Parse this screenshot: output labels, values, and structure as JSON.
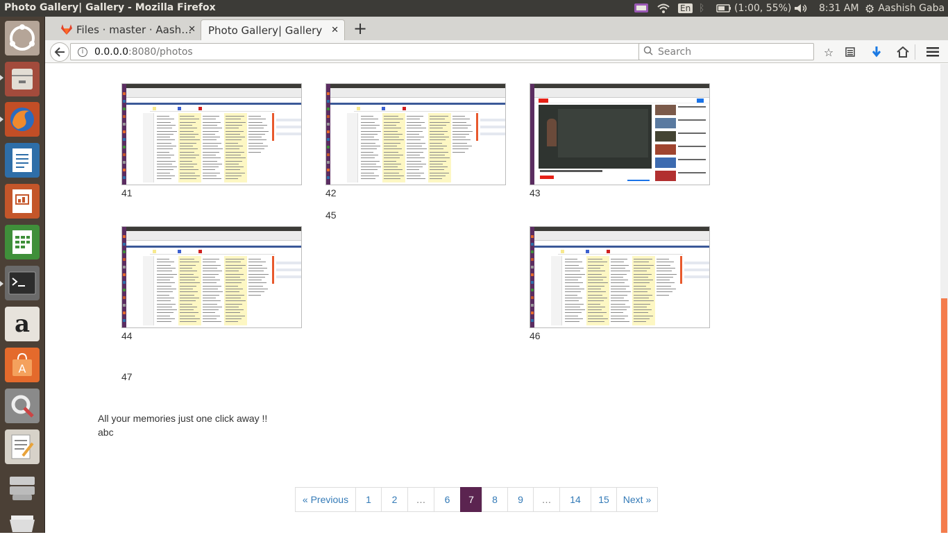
{
  "panel": {
    "window_title": "Photo Gallery| Gallery - Mozilla Firefox",
    "keyboard": "En",
    "battery": "(1:00, 55%)",
    "time": "8:31 AM",
    "user": "Aashish Gaba"
  },
  "launcher": {
    "items": [
      "Ubuntu",
      "Files",
      "Firefox Web Browser",
      "LibreOffice Writer",
      "LibreOffice Impress",
      "LibreOffice Calc",
      "Terminal",
      "Amazon",
      "Ubuntu Software",
      "System Settings",
      "Text Editor",
      "Workspace Switcher",
      "Trash"
    ]
  },
  "browser": {
    "tabs": [
      {
        "label": "Files · master · Aash…",
        "active": false
      },
      {
        "label": "Photo Gallery| Gallery",
        "active": true
      }
    ],
    "new_tab": "+",
    "url_host": "0.0.0.0",
    "url_rest": ":8080/photos",
    "search_placeholder": "Search"
  },
  "gallery": {
    "items": [
      {
        "number": "41",
        "has_image": true,
        "kind": "timetable"
      },
      {
        "number": "42",
        "has_image": true,
        "kind": "timetable"
      },
      {
        "number": "43",
        "has_image": true,
        "kind": "youtube"
      },
      {
        "number": "44",
        "has_image": true,
        "kind": "timetable"
      },
      {
        "number": "45",
        "has_image": false
      },
      {
        "number": "46",
        "has_image": true,
        "kind": "timetable"
      },
      {
        "number": "47",
        "has_image": false
      }
    ],
    "tagline": "All your memories just one click away !!",
    "subline": "abc"
  },
  "pagination": {
    "items": [
      {
        "label": "« Previous",
        "state": "normal"
      },
      {
        "label": "1",
        "state": "normal"
      },
      {
        "label": "2",
        "state": "normal"
      },
      {
        "label": "…",
        "state": "disabled"
      },
      {
        "label": "6",
        "state": "normal"
      },
      {
        "label": "7",
        "state": "active"
      },
      {
        "label": "8",
        "state": "normal"
      },
      {
        "label": "9",
        "state": "normal"
      },
      {
        "label": "…",
        "state": "disabled"
      },
      {
        "label": "14",
        "state": "normal"
      },
      {
        "label": "15",
        "state": "normal"
      },
      {
        "label": "Next »",
        "state": "normal"
      }
    ]
  },
  "colors": {
    "active_page": "#5b2450",
    "link": "#337ab7",
    "launcher_bg": "#4b4036",
    "panel_bg": "#3c3b37"
  }
}
